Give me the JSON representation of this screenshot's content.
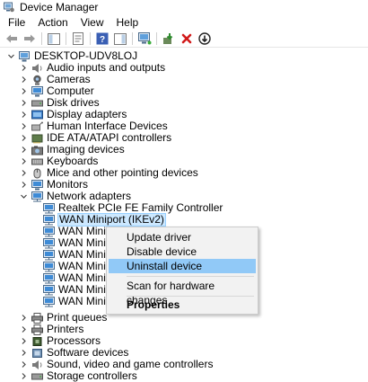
{
  "window": {
    "title": "Device Manager"
  },
  "menubar": {
    "items": [
      "File",
      "Action",
      "View",
      "Help"
    ]
  },
  "tree": {
    "root": "DESKTOP-UDV8LOJ",
    "categories": [
      "Audio inputs and outputs",
      "Cameras",
      "Computer",
      "Disk drives",
      "Display adapters",
      "Human Interface Devices",
      "IDE ATA/ATAPI controllers",
      "Imaging devices",
      "Keyboards",
      "Mice and other pointing devices",
      "Monitors",
      "Network adapters"
    ],
    "network_children": [
      "Realtek PCIe FE Family Controller",
      "WAN Miniport (IKEv2)",
      "WAN Minipo",
      "WAN Minipo",
      "WAN Minipo",
      "WAN Minipo",
      "WAN Minipo",
      "WAN Miniport",
      "WAN Miniport"
    ],
    "categories_after": [
      "Print queues",
      "Printers",
      "Processors",
      "Software devices",
      "Sound, video and game controllers",
      "Storage controllers"
    ]
  },
  "context_menu": {
    "items": [
      "Update driver",
      "Disable device",
      "Uninstall device",
      "Scan for hardware changes",
      "Properties"
    ]
  },
  "colors": {
    "selection": "#cce8ff",
    "menu_highlight": "#91c9f7",
    "menu_background": "#f2f2f2"
  }
}
